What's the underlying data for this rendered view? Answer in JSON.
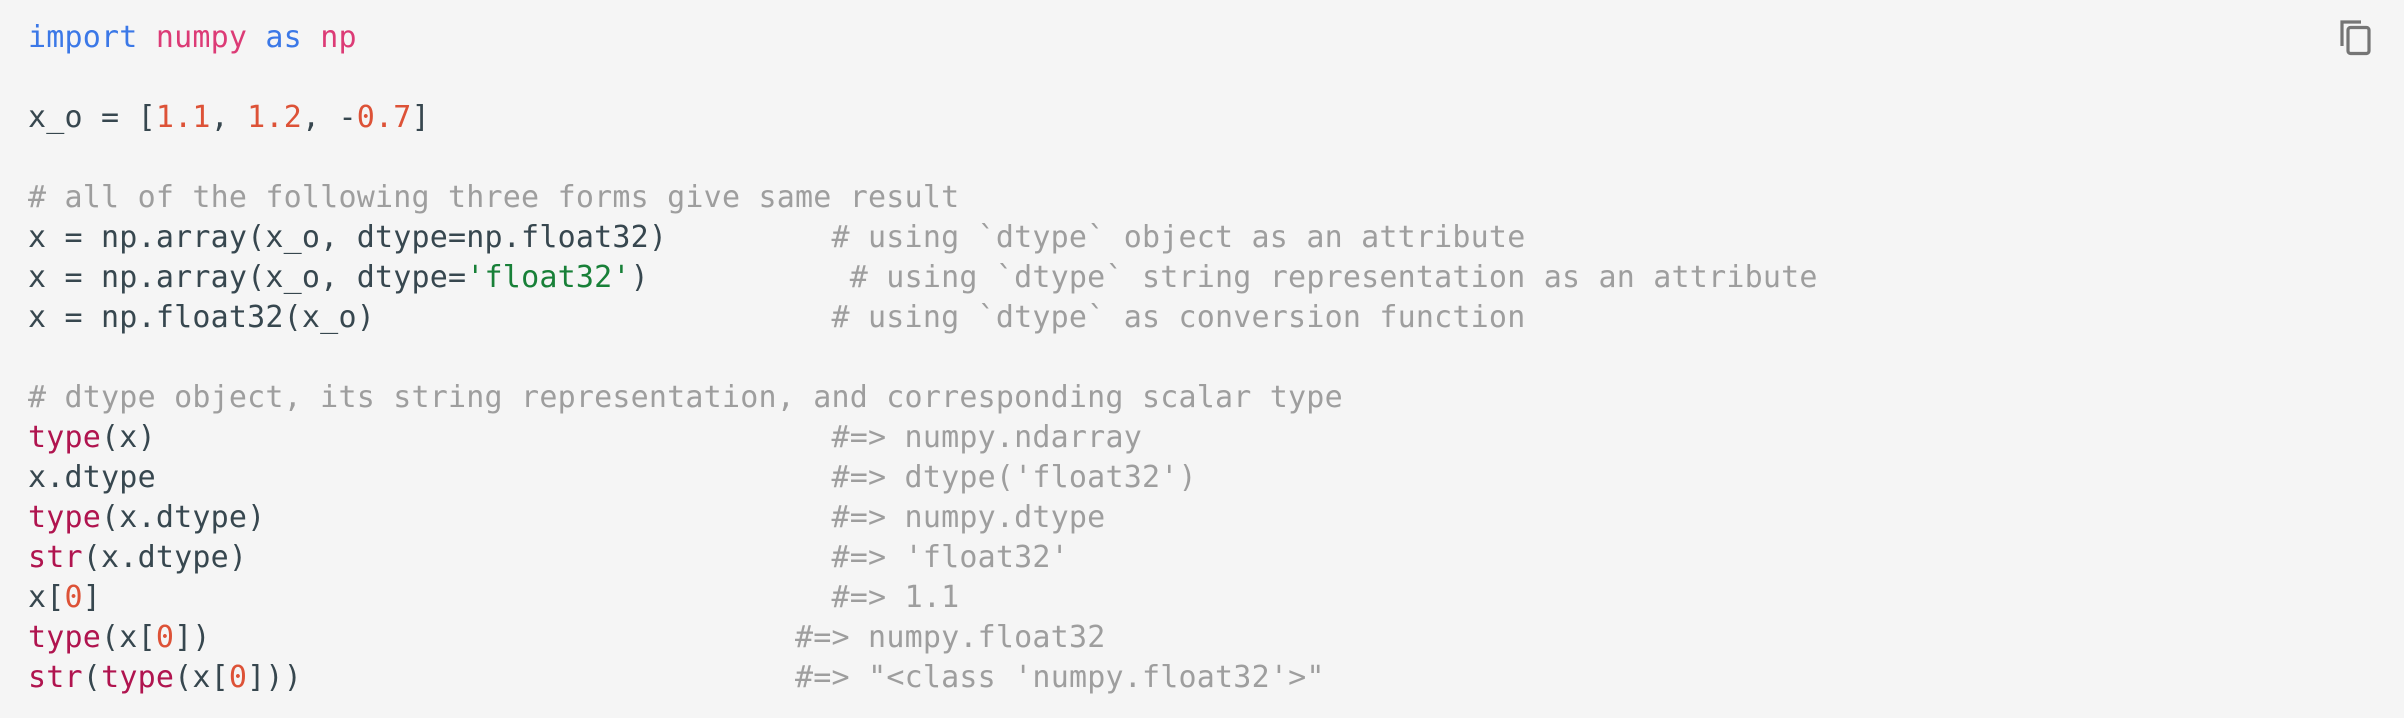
{
  "code_block": {
    "language": "python",
    "copy_button": {
      "icon": "copy-icon",
      "label": "Copy code"
    },
    "lines": [
      [
        {
          "t": "import",
          "c": "kw"
        },
        {
          "t": " ",
          "c": "plain"
        },
        {
          "t": "numpy",
          "c": "mod"
        },
        {
          "t": " ",
          "c": "plain"
        },
        {
          "t": "as",
          "c": "kw"
        },
        {
          "t": " ",
          "c": "plain"
        },
        {
          "t": "np",
          "c": "mod"
        }
      ],
      [],
      [
        {
          "t": "x_o = [",
          "c": "plain"
        },
        {
          "t": "1.1",
          "c": "num"
        },
        {
          "t": ", ",
          "c": "plain"
        },
        {
          "t": "1.2",
          "c": "num"
        },
        {
          "t": ", -",
          "c": "plain"
        },
        {
          "t": "0.7",
          "c": "num"
        },
        {
          "t": "]",
          "c": "plain"
        }
      ],
      [],
      [
        {
          "t": "# all of the following three forms give same result",
          "c": "cmt"
        }
      ],
      [
        {
          "t": "x = np.array(x_o, dtype=np.float32)         ",
          "c": "plain"
        },
        {
          "t": "# using `dtype` object as an attribute",
          "c": "cmt"
        }
      ],
      [
        {
          "t": "x = np.array(x_o, dtype=",
          "c": "plain"
        },
        {
          "t": "'float32'",
          "c": "str"
        },
        {
          "t": ")           ",
          "c": "plain"
        },
        {
          "t": "# using `dtype` string representation as an attribute",
          "c": "cmt"
        }
      ],
      [
        {
          "t": "x = np.float32(x_o)                         ",
          "c": "plain"
        },
        {
          "t": "# using `dtype` as conversion function",
          "c": "cmt"
        }
      ],
      [],
      [
        {
          "t": "# dtype object, its string representation, and corresponding scalar type",
          "c": "cmt"
        }
      ],
      [
        {
          "t": "type",
          "c": "fn"
        },
        {
          "t": "(x)                                     ",
          "c": "plain"
        },
        {
          "t": "#=> numpy.ndarray",
          "c": "cmt"
        }
      ],
      [
        {
          "t": "x.dtype                                     ",
          "c": "plain"
        },
        {
          "t": "#=> dtype('float32')",
          "c": "cmt"
        }
      ],
      [
        {
          "t": "type",
          "c": "fn"
        },
        {
          "t": "(x.dtype)                               ",
          "c": "plain"
        },
        {
          "t": "#=> numpy.dtype",
          "c": "cmt"
        }
      ],
      [
        {
          "t": "str",
          "c": "fn"
        },
        {
          "t": "(x.dtype)                                ",
          "c": "plain"
        },
        {
          "t": "#=> 'float32'",
          "c": "cmt"
        }
      ],
      [
        {
          "t": "x[",
          "c": "plain"
        },
        {
          "t": "0",
          "c": "num"
        },
        {
          "t": "]                                        ",
          "c": "plain"
        },
        {
          "t": "#=> 1.1",
          "c": "cmt"
        }
      ],
      [
        {
          "t": "type",
          "c": "fn"
        },
        {
          "t": "(x[",
          "c": "plain"
        },
        {
          "t": "0",
          "c": "num"
        },
        {
          "t": "])                                ",
          "c": "plain"
        },
        {
          "t": "#=> numpy.float32",
          "c": "cmt"
        }
      ],
      [
        {
          "t": "str",
          "c": "fn"
        },
        {
          "t": "(",
          "c": "plain"
        },
        {
          "t": "type",
          "c": "fn"
        },
        {
          "t": "(x[",
          "c": "plain"
        },
        {
          "t": "0",
          "c": "num"
        },
        {
          "t": "]))                           ",
          "c": "plain"
        },
        {
          "t": "#=> \"<class 'numpy.float32'>\"",
          "c": "cmt"
        }
      ]
    ]
  }
}
